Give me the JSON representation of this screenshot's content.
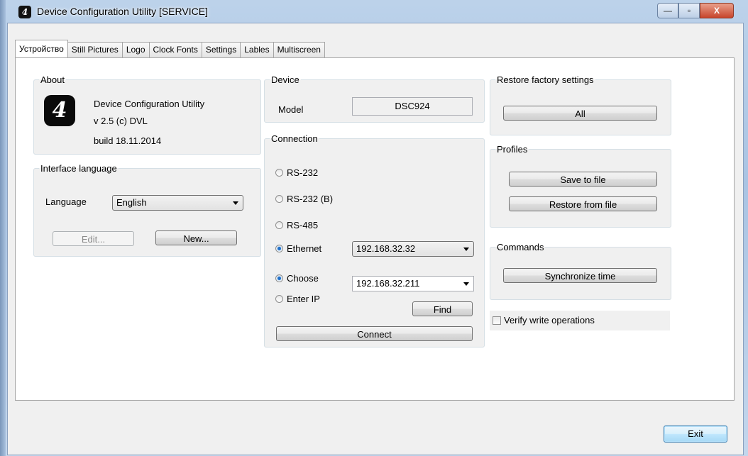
{
  "window": {
    "title": "Device Configuration Utility [SERVICE]",
    "icon": "app-logo-icon",
    "controls": {
      "minimize": "—",
      "maximize": "▫",
      "close": "X"
    }
  },
  "tabs": [
    "Устройство",
    "Still Pictures",
    "Logo",
    "Clock Fonts",
    "Settings",
    "Lables",
    "Multiscreen"
  ],
  "about": {
    "legend": "About",
    "name": "Device Configuration Utility",
    "version": "v 2.5  (c) DVL",
    "build": "build  18.11.2014"
  },
  "interface_language": {
    "legend": "Interface language",
    "label": "Language",
    "value": "English",
    "edit_button": "Edit...",
    "new_button": "New..."
  },
  "device": {
    "legend": "Device",
    "model_label": "Model",
    "model_value": "DSC924"
  },
  "connection": {
    "legend": "Connection",
    "options": [
      "RS-232",
      "RS-232 (B)",
      "RS-485",
      "Ethernet"
    ],
    "selected": "Ethernet",
    "ethernet_ip": "192.168.32.32",
    "mode_choose": "Choose",
    "mode_enter_ip": "Enter IP",
    "mode_selected": "Choose",
    "target_ip": "192.168.32.211",
    "find_button": "Find",
    "connect_button": "Connect"
  },
  "restore": {
    "legend": "Restore factory settings",
    "all_button": "All"
  },
  "profiles": {
    "legend": "Profiles",
    "save_button": "Save to file",
    "restore_button": "Restore from file"
  },
  "commands": {
    "legend": "Commands",
    "sync_button": "Synchronize time"
  },
  "verify": {
    "label": "Verify write operations",
    "checked": false
  },
  "footer": {
    "exit_button": "Exit"
  },
  "colors": {
    "accent": "#3c7fb1",
    "radio_selected": "#1f6fc9",
    "close_button": "#c7452b"
  }
}
